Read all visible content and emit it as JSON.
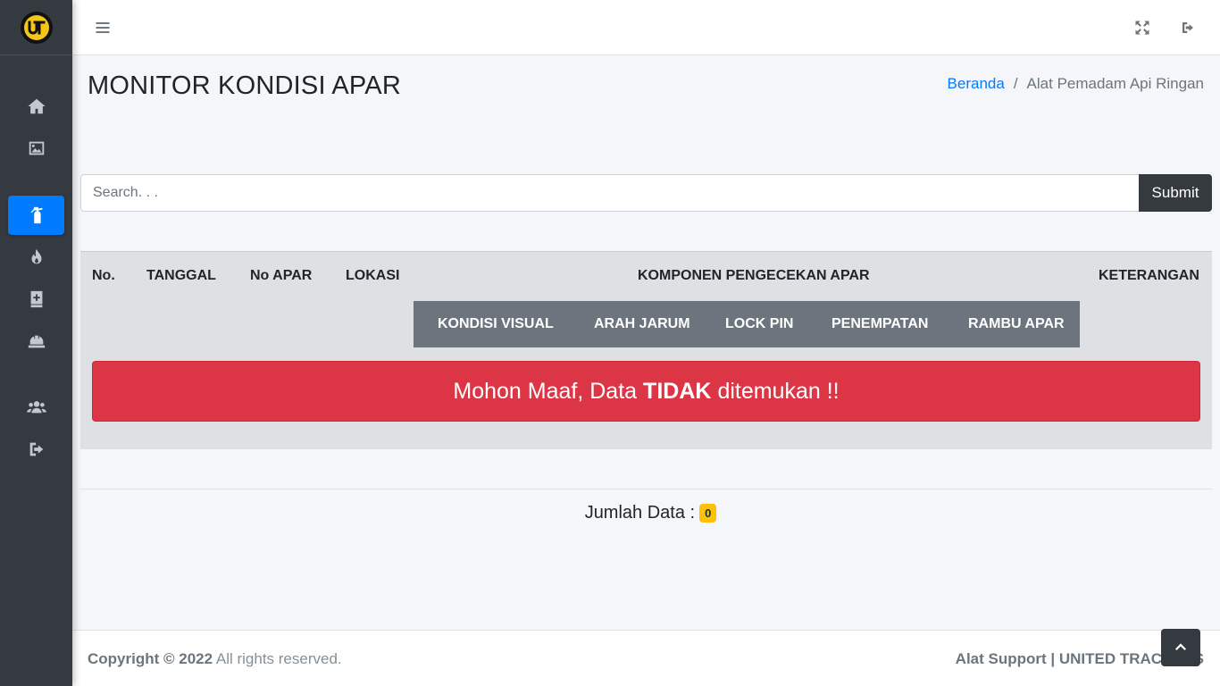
{
  "sidebar": {
    "logo_icon": "ut-logo-icon",
    "items": [
      {
        "icon": "home-icon",
        "active": false
      },
      {
        "icon": "image-icon",
        "active": false
      },
      {
        "icon": "fire-extinguisher-icon",
        "active": true
      },
      {
        "icon": "fire-icon",
        "active": false
      },
      {
        "icon": "medical-book-icon",
        "active": false
      },
      {
        "icon": "hard-hat-icon",
        "active": false
      },
      {
        "icon": "users-icon",
        "active": false
      },
      {
        "icon": "sign-out-icon",
        "active": false
      }
    ],
    "active_color": "#007bff"
  },
  "navbar": {
    "menu_icon": "hamburger-menu-icon",
    "fullscreen_icon": "expand-icon",
    "logout_icon": "sign-out-icon"
  },
  "page": {
    "title": "MONITOR KONDISI APAR",
    "breadcrumb": {
      "home": "Beranda",
      "separator": "/",
      "current": "Alat Pemadam Api Ringan"
    }
  },
  "search": {
    "placeholder": "Search. . .",
    "value": "",
    "submit_label": "Submit"
  },
  "table": {
    "headers": {
      "no": "No.",
      "tanggal": "TANGGAL",
      "no_apar": "No APAR",
      "lokasi": "LOKASI",
      "komponen": "KOMPONEN PENGECEKAN APAR",
      "keterangan": "KETERANGAN"
    },
    "sub_headers": [
      "KONDISI VISUAL",
      "ARAH JARUM",
      "LOCK PIN",
      "PENEMPATAN",
      "RAMBU APAR"
    ],
    "rows": [],
    "empty_message": {
      "before": "Mohon Maaf, Data",
      "emphasis": "TIDAK",
      "after": "ditemukan !!"
    }
  },
  "summary": {
    "label": "Jumlah Data :",
    "count": "0"
  },
  "footer": {
    "copyright_bold": "Copyright © 2022",
    "copyright_rest": "All rights reserved.",
    "right_text": "Alat Support | UNITED TRACTORS"
  },
  "colors": {
    "sidebar_bg": "#343a40",
    "danger": "#dc3545",
    "badge": "#ffc107",
    "link": "#007bff"
  }
}
